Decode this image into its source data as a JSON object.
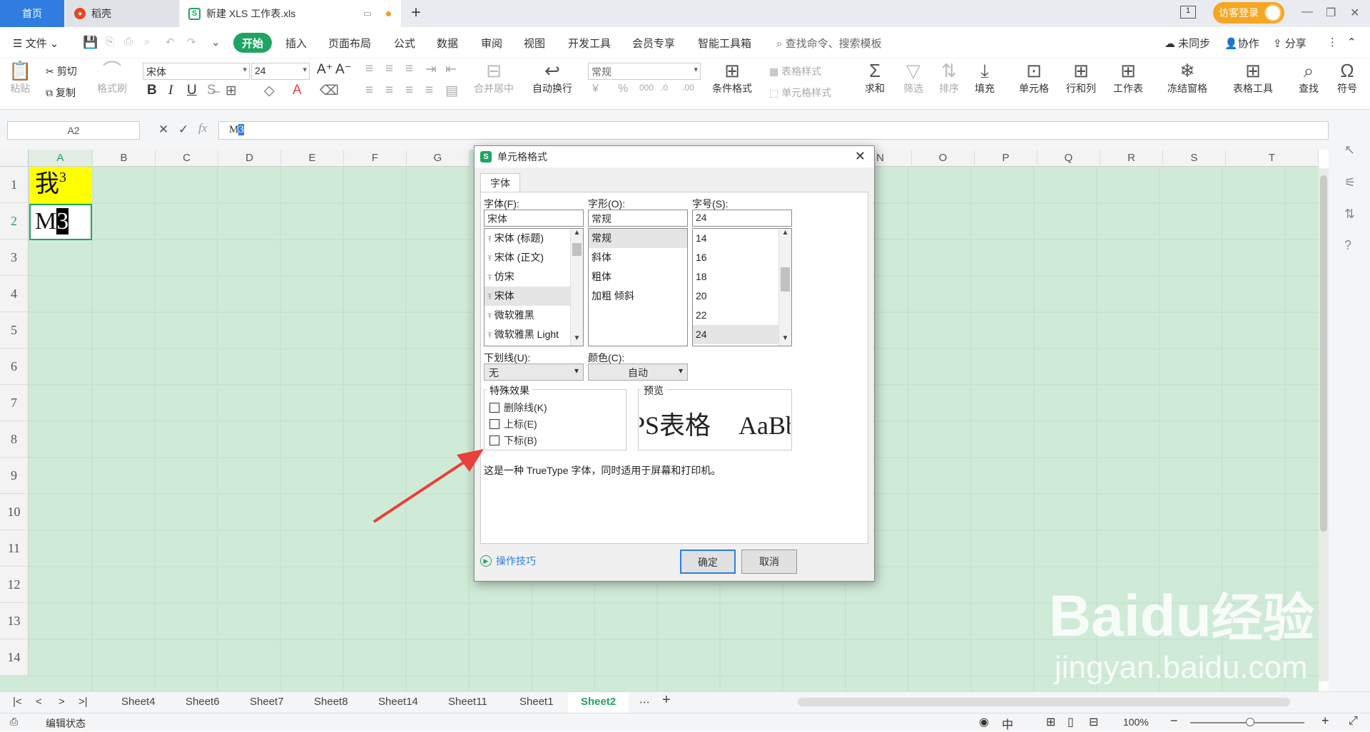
{
  "tabs": {
    "home": "首页",
    "daoke": "稻壳",
    "file": "新建 XLS 工作表.xls",
    "add": "+"
  },
  "account": {
    "login": "访客登录"
  },
  "menu": {
    "file": "文件",
    "start": "开始",
    "insert": "插入",
    "layout": "页面布局",
    "formula": "公式",
    "data": "数据",
    "review": "审阅",
    "view": "视图",
    "dev": "开发工具",
    "member": "会员专享",
    "smart": "智能工具箱",
    "search": "查找命令、搜索模板",
    "sync": "未同步",
    "collab": "协作",
    "share": "分享"
  },
  "ribbon": {
    "paste": "粘贴",
    "cut": "剪切",
    "copy": "复制",
    "format_painter": "格式刷",
    "font": "宋体",
    "font_size": "24",
    "number_format": "常规",
    "merge": "合并居中",
    "wrap": "自动换行",
    "cond_format": "条件格式",
    "table_style": "表格样式",
    "cell_style": "单元格样式",
    "sum": "求和",
    "filter": "筛选",
    "sort": "排序",
    "fill": "填充",
    "cell": "单元格",
    "rowcol": "行和列",
    "sheet": "工作表",
    "freeze": "冻结窗格",
    "table_tools": "表格工具",
    "find": "查找",
    "symbol": "符号",
    "bold": "B",
    "italic": "I",
    "underline": "U",
    "percent": "%",
    "thousands": "000"
  },
  "formula_bar": {
    "name_box": "A2",
    "fx": "fx",
    "value_plain": "M",
    "value_selected": "3"
  },
  "columns": [
    "A",
    "B",
    "C",
    "D",
    "E",
    "F",
    "G",
    "N",
    "O",
    "P",
    "Q",
    "R",
    "S",
    "T"
  ],
  "rows": [
    "1",
    "2",
    "3",
    "4",
    "5",
    "6",
    "7",
    "8",
    "9",
    "10",
    "11",
    "12",
    "13",
    "14"
  ],
  "cells": {
    "A1_main": "我",
    "A1_sup": "3",
    "A2_plain": "M",
    "A2_selected": "3"
  },
  "sheets": [
    "Sheet4",
    "Sheet6",
    "Sheet7",
    "Sheet8",
    "Sheet14",
    "Sheet11",
    "Sheet1",
    "Sheet2"
  ],
  "active_sheet": "Sheet2",
  "status": {
    "mode": "编辑状态",
    "zoom": "100%"
  },
  "dialog": {
    "title": "单元格格式",
    "tab": "字体",
    "font_label": "字体(F):",
    "font_value": "宋体",
    "font_list": [
      "宋体 (标题)",
      "宋体 (正文)",
      "仿宋",
      "宋体",
      "微软雅黑",
      "微软雅黑 Light"
    ],
    "style_label": "字形(O):",
    "style_value": "常规",
    "style_list": [
      "常规",
      "斜体",
      "粗体",
      "加粗 倾斜"
    ],
    "size_label": "字号(S):",
    "size_value": "24",
    "size_list": [
      "14",
      "16",
      "18",
      "20",
      "22",
      "24"
    ],
    "underline_label": "下划线(U):",
    "underline_value": "无",
    "color_label": "颜色(C):",
    "color_value": "自动",
    "effects_label": "特殊效果",
    "strike": "删除线(K)",
    "superscript": "上标(E)",
    "subscript": "下标(B)",
    "preview_label": "预览",
    "preview_text1": "PS表格",
    "preview_text2": "AaBbC",
    "note": "这是一种 TrueType 字体，同时适用于屏幕和打印机。",
    "tips": "操作技巧",
    "ok": "确定",
    "cancel": "取消"
  },
  "watermark": {
    "brand": "Bai",
    "brand2": "du",
    "brand3": "经验",
    "url": "jingyan.baidu.com"
  },
  "colors": {
    "accent": "#1fa463",
    "grid_bg": "#d0ead8",
    "highlight": "#ffff00",
    "arrow": "#e8403a",
    "blue": "#2f7de1"
  }
}
